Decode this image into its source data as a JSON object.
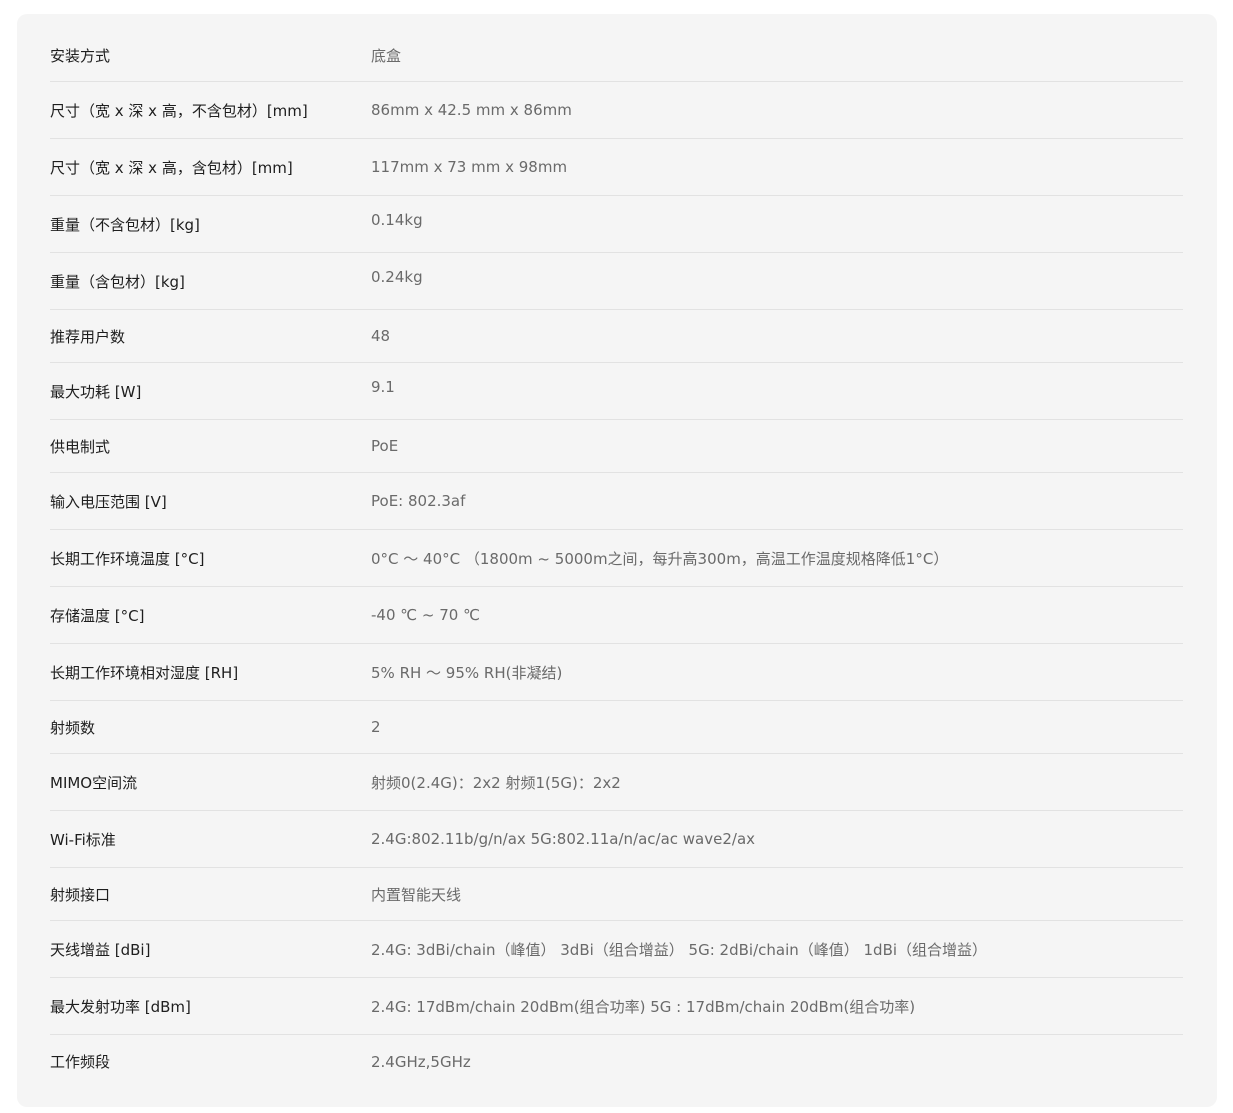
{
  "specs": [
    {
      "label": "安装方式",
      "value": "底盒"
    },
    {
      "label": "尺寸（宽 x 深 x 高，不含包材）[mm]",
      "value": "86mm x 42.5 mm x 86mm"
    },
    {
      "label": "尺寸（宽 x 深 x 高，含包材）[mm]",
      "value": "117mm x 73 mm x 98mm"
    },
    {
      "label": "重量（不含包材）[kg]",
      "value": "0.14kg"
    },
    {
      "label": "重量（含包材）[kg]",
      "value": "0.24kg"
    },
    {
      "label": "推荐用户数",
      "value": "48"
    },
    {
      "label": "最大功耗 [W]",
      "value": "9.1"
    },
    {
      "label": "供电制式",
      "value": "PoE"
    },
    {
      "label": "输入电压范围 [V]",
      "value": "PoE: 802.3af"
    },
    {
      "label": "长期工作环境温度 [°C]",
      "value": "0°C ～ 40°C （1800m ~ 5000m之间，每升高300m，高温工作温度规格降低1°C）"
    },
    {
      "label": "存储温度 [°C]",
      "value": "-40 ℃ ~  70 ℃"
    },
    {
      "label": "长期工作环境相对湿度 [RH]",
      "value": "5% RH  ～ 95% RH(非凝结)"
    },
    {
      "label": "射频数",
      "value": "2"
    },
    {
      "label": "MIMO空间流",
      "value": "射频0(2.4G)：2x2 射频1(5G)：2x2"
    },
    {
      "label": "Wi-Fi标准",
      "value": "2.4G:802.11b/g/n/ax 5G:802.11a/n/ac/ac wave2/ax"
    },
    {
      "label": "射频接口",
      "value": "内置智能天线"
    },
    {
      "label": "天线增益 [dBi]",
      "value": "2.4G: 3dBi/chain（峰值） 3dBi（组合增益） 5G: 2dBi/chain（峰值） 1dBi（组合增益）"
    },
    {
      "label": "最大发射功率 [dBm]",
      "value": "2.4G: 17dBm/chain 20dBm(组合功率) 5G : 17dBm/chain 20dBm(组合功率)"
    },
    {
      "label": "工作频段",
      "value": "2.4GHz,5GHz"
    }
  ]
}
